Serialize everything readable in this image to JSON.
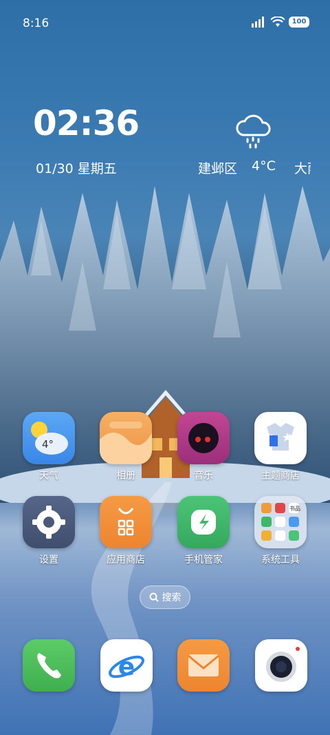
{
  "status_bar": {
    "time": "8:16",
    "battery": "100"
  },
  "clock_widget": {
    "time": "02:36",
    "date": "01/30 星期五",
    "location": "建邺区",
    "temperature": "4°C",
    "condition": "大雨",
    "icon": "rain-cloud-icon"
  },
  "apps": [
    {
      "label": "天气",
      "icon": "weather-icon",
      "badge": "4°"
    },
    {
      "label": "相册",
      "icon": "gallery-icon"
    },
    {
      "label": "音乐",
      "icon": "music-icon"
    },
    {
      "label": "主题商店",
      "icon": "theme-store-icon"
    },
    {
      "label": "设置",
      "icon": "gear-icon"
    },
    {
      "label": "应用商店",
      "icon": "app-store-icon"
    },
    {
      "label": "手机管家",
      "icon": "phone-manager-icon"
    },
    {
      "label": "系统工具",
      "icon": "folder-icon"
    }
  ],
  "folder_labels": {
    "top_right": "书品"
  },
  "search": {
    "label": "搜索",
    "icon": "search-icon"
  },
  "dock": [
    {
      "name": "phone",
      "icon": "phone-icon"
    },
    {
      "name": "browser",
      "icon": "browser-icon"
    },
    {
      "name": "mail",
      "icon": "mail-icon"
    },
    {
      "name": "camera",
      "icon": "camera-icon"
    }
  ],
  "colors": {
    "weather": "#4a9af0",
    "gallery": "#f0a050",
    "music": "#b03a8a",
    "settings": "#4b5a78",
    "app_store": "#f08a32",
    "phone_manager": "#3fb86a",
    "phone": "#4cbf5a",
    "mail": "#f08a32"
  }
}
